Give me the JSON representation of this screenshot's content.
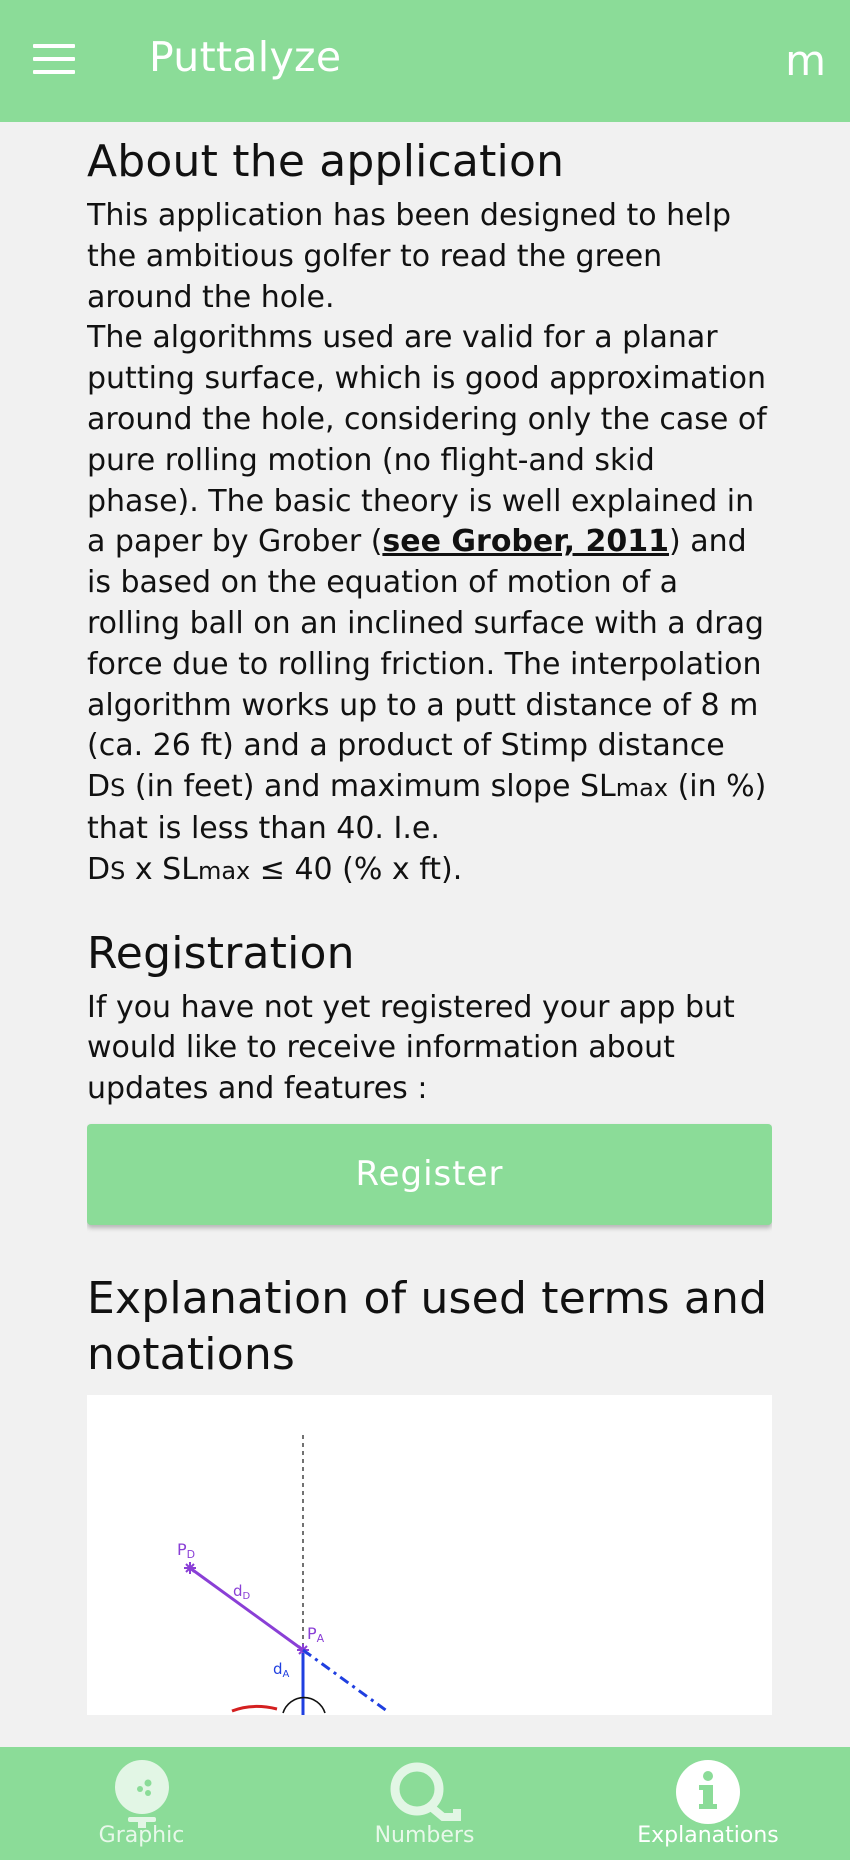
{
  "appbar": {
    "title": "Puttalyze",
    "menu_icon": "hamburger-menu-icon",
    "lang_label": "m"
  },
  "about": {
    "heading": "About the application",
    "p1": "This application has been designed to help the ambitious golfer to read the green around the hole.",
    "p2_before_link": "The algorithms used are valid for a planar putting surface, which is good approximation around the hole, considering only the case of pure rolling motion (no flight-and skid phase). The basic theory is well explained in a paper by Grober (",
    "p2_link": "see Grober, 2011",
    "p2_after_link": ") and is based on the equation of motion of a rolling ball on an inclined surface with a drag force due to rolling friction. The interpolation algorithm works up to a putt distance of 8 m (ca. 26 ft) and a product of Stimp distance D",
    "ds_sub": "S",
    "p2_mid": " (in feet) and maximum slope SL",
    "slmax_sub": "max",
    "p2_end": " (in %) that is less than 40. I.e.",
    "formula_d": "D",
    "formula_s": "S",
    "formula_x": " x SL",
    "formula_max": "max",
    "formula_end": " ≤ 40 (% x ft)."
  },
  "registration": {
    "heading": "Registration",
    "text": "If you have not yet registered your app but would like to receive information about updates and features :",
    "button_label": "Register"
  },
  "explanation": {
    "heading": "Explanation of used terms and notations",
    "diagram_labels": {
      "pd": "P",
      "pd_sub": "D",
      "dd": "d",
      "dd_sub": "D",
      "pa": "P",
      "pa_sub": "A",
      "da": "d",
      "da_sub": "A"
    }
  },
  "bottom_nav": {
    "items": [
      {
        "label": "Graphic",
        "icon": "golf-ball-icon",
        "active": false
      },
      {
        "label": "Numbers",
        "icon": "magnifier-icon",
        "active": false
      },
      {
        "label": "Explanations",
        "icon": "info-icon",
        "active": true
      }
    ]
  },
  "colors": {
    "primary": "#8bdc98",
    "background": "#f1f1f1",
    "diagram_purple": "#8a3fd6",
    "diagram_blue": "#1f3fe0",
    "diagram_red": "#d42020"
  }
}
